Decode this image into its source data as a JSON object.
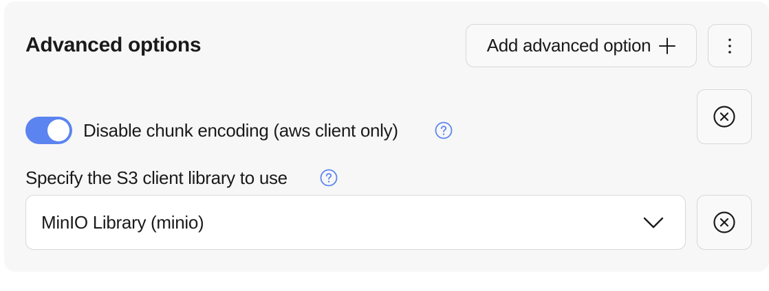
{
  "section": {
    "title": "Advanced options",
    "add_button_label": "Add advanced option",
    "add_icon": "plus-icon",
    "more_icon": "vertical-ellipsis-icon"
  },
  "options": {
    "chunk_encoding": {
      "label": "Disable chunk encoding (aws client only)",
      "enabled": true,
      "help_icon": "question-circle-icon",
      "remove_icon": "close-circle-icon"
    },
    "client_library": {
      "label": "Specify the S3 client library to use",
      "selected_value": "MinIO Library (minio)",
      "help_icon": "question-circle-icon",
      "dropdown_icon": "chevron-down-icon",
      "remove_icon": "close-circle-icon"
    }
  },
  "colors": {
    "panel_background": "#f7f7f7",
    "toggle_on": "#5b84f0",
    "help_icon": "#5b84f0",
    "border": "#d7d7d7",
    "text": "#1a1a1a"
  }
}
